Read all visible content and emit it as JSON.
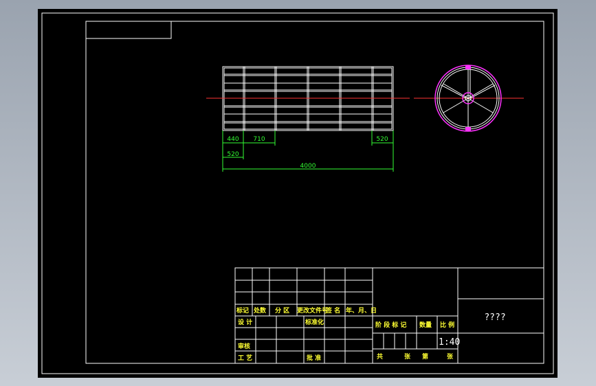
{
  "dimensions": {
    "d440": "440",
    "d710": "710",
    "d520_right": "520",
    "d520_left": "520",
    "d4000": "4000"
  },
  "title_block": {
    "mark": "标记",
    "count": "处数",
    "zone": "分 区",
    "change_doc": "更改文件号",
    "signature": "签 名",
    "date": "年、月、日",
    "design": "设 计",
    "standardize": "标准化",
    "stage_mark": "阶 段 标 记",
    "quantity": "数量",
    "scale_label": "比 例",
    "scale_value": "1:40",
    "review": "审核",
    "craft": "工 艺",
    "approve": "批 准",
    "total": "共",
    "sheets": "张",
    "sheet_no": "第",
    "sheet_unit": "张",
    "drawing_name": "????"
  },
  "colors": {
    "background": "#000000",
    "line": "#ffffff",
    "dimension": "#33ff33",
    "centerline": "#ff3333",
    "wheel": "#ff33ff",
    "text": "#ffff33"
  }
}
